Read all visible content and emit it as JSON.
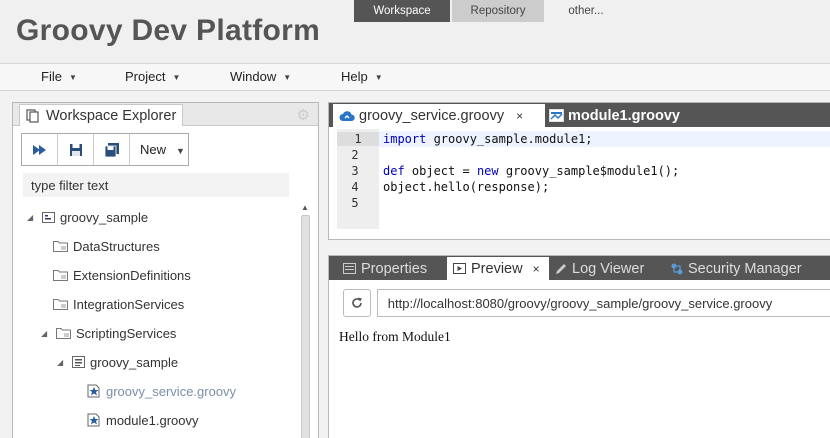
{
  "app": {
    "title": "Groovy Dev Platform"
  },
  "perspectives": [
    {
      "label": "Workspace"
    },
    {
      "label": "Repository"
    },
    {
      "label": "other..."
    }
  ],
  "menu": [
    {
      "label": "File"
    },
    {
      "label": "Project"
    },
    {
      "label": "Window"
    },
    {
      "label": "Help"
    }
  ],
  "explorer": {
    "title": "Workspace Explorer",
    "toolbar": {
      "new_label": "New"
    },
    "filter_placeholder": "type filter text",
    "tree": [
      {
        "label": "groovy_sample",
        "depth": 0,
        "expanded": true,
        "icon": "project-icon"
      },
      {
        "label": "DataStructures",
        "depth": 1,
        "icon": "folder-icon"
      },
      {
        "label": "ExtensionDefinitions",
        "depth": 1,
        "icon": "folder-icon"
      },
      {
        "label": "IntegrationServices",
        "depth": 1,
        "icon": "folder-icon"
      },
      {
        "label": "ScriptingServices",
        "depth": 1,
        "expanded": true,
        "icon": "folder-icon"
      },
      {
        "label": "groovy_sample",
        "depth": 2,
        "expanded": true,
        "icon": "package-icon"
      },
      {
        "label": "groovy_service.groovy",
        "depth": 3,
        "icon": "groovy-file-icon",
        "selected": true
      },
      {
        "label": "module1.groovy",
        "depth": 3,
        "icon": "groovy-file-icon"
      }
    ]
  },
  "editor": {
    "tabs": [
      {
        "label": "groovy_service.groovy",
        "active": true,
        "close": "×"
      },
      {
        "label": "module1.groovy",
        "active": false
      }
    ],
    "line_numbers": [
      "1",
      "2",
      "3",
      "4",
      "5"
    ],
    "lines": [
      {
        "kw": "import",
        "rest": " groovy_sample.module1;"
      },
      {
        "kw": "",
        "rest": ""
      },
      {
        "kw": "def",
        "rest": " object = ",
        "kw2": "new",
        "rest2": " groovy_sample$module1();"
      },
      {
        "kw": "",
        "rest": "object.hello(response);"
      },
      {
        "kw": "",
        "rest": ""
      }
    ]
  },
  "preview": {
    "tabs": [
      {
        "label": "Properties"
      },
      {
        "label": "Preview",
        "active": true,
        "close": "×"
      },
      {
        "label": "Log Viewer"
      },
      {
        "label": "Security Manager"
      }
    ],
    "url": "http://localhost:8080/groovy/groovy_sample/groovy_service.groovy",
    "content": "Hello from Module1"
  },
  "colors": {
    "header_bg": "#f0f0f0",
    "tab_dark": "#555555",
    "keyword": "#0000c0",
    "link": "#7a8fa6"
  }
}
